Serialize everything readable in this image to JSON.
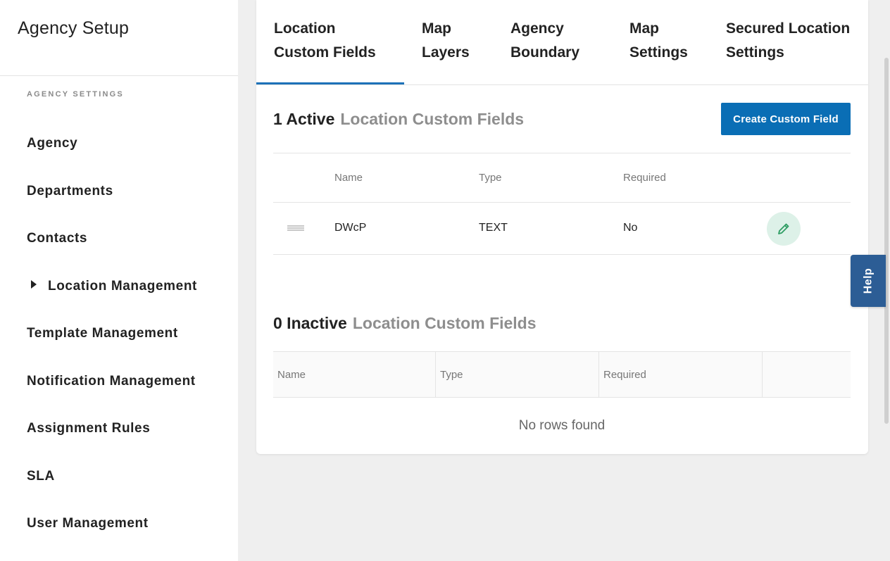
{
  "sidebar": {
    "title": "Agency Setup",
    "section_label": "AGENCY SETTINGS",
    "items": [
      {
        "label": "Agency"
      },
      {
        "label": "Departments"
      },
      {
        "label": "Contacts"
      },
      {
        "label": "Location Management",
        "expandable": true
      },
      {
        "label": "Template Management"
      },
      {
        "label": "Notification Management"
      },
      {
        "label": "Assignment Rules"
      },
      {
        "label": "SLA"
      },
      {
        "label": "User Management"
      }
    ]
  },
  "tabs": [
    {
      "line1": "Location",
      "line2": "Custom Fields",
      "active": true
    },
    {
      "line1": "Map",
      "line2": "Layers"
    },
    {
      "line1": "Agency",
      "line2": "Boundary"
    },
    {
      "line1": "Map",
      "line2": "Settings"
    },
    {
      "line1": "Secured Location",
      "line2": "Settings"
    }
  ],
  "active_section": {
    "count_label": "1 Active",
    "subtitle": "Location Custom Fields",
    "create_button": "Create Custom Field",
    "columns": [
      "Name",
      "Type",
      "Required"
    ],
    "rows": [
      {
        "name": "DWcP",
        "type": "TEXT",
        "required": "No"
      }
    ]
  },
  "inactive_section": {
    "count_label": "0 Inactive",
    "subtitle": "Location Custom Fields",
    "columns": [
      "Name",
      "Type",
      "Required"
    ],
    "empty_message": "No rows found"
  },
  "help": {
    "label": "Help"
  },
  "colors": {
    "primary": "#0a6eb5",
    "tab_underline": "#1d71b8",
    "help_tab": "#2c5d95",
    "edit_bg": "#ddf1e8",
    "edit_icon": "#2e9d63"
  },
  "icons": {
    "row_drag": "drag-handle-icon",
    "row_edit": "pencil-icon",
    "nav_expand": "caret-right-icon"
  }
}
